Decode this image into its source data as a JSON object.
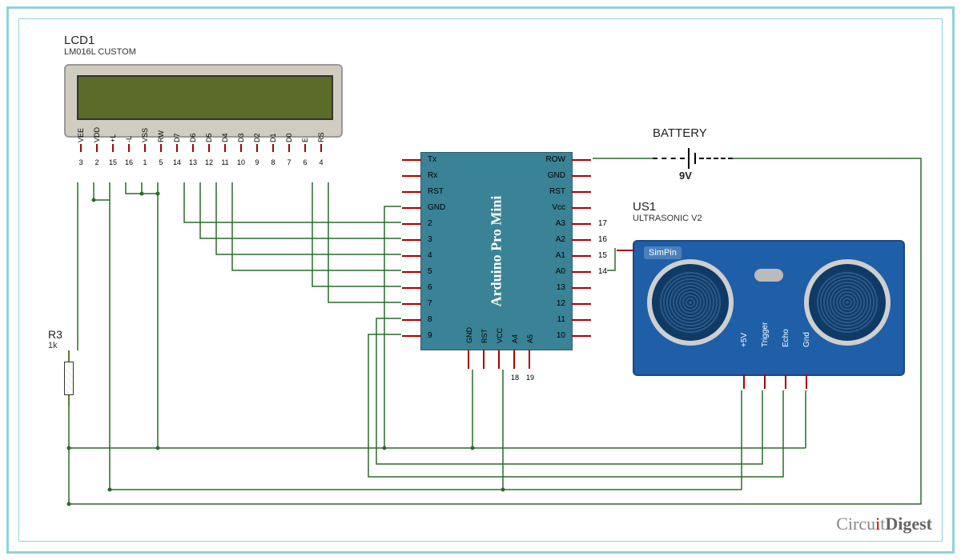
{
  "lcd": {
    "ref": "LCD1",
    "value": "LM016L CUSTOM",
    "pins": [
      {
        "label": "VEE",
        "num": "3"
      },
      {
        "label": "VDD",
        "num": "2"
      },
      {
        "label": "+L",
        "num": "15"
      },
      {
        "label": "-L",
        "num": "16"
      },
      {
        "label": "VSS",
        "num": "1"
      },
      {
        "label": "RW",
        "num": "5"
      },
      {
        "label": "D7",
        "num": "14"
      },
      {
        "label": "D6",
        "num": "13"
      },
      {
        "label": "D5",
        "num": "12"
      },
      {
        "label": "D4",
        "num": "11"
      },
      {
        "label": "D3",
        "num": "10"
      },
      {
        "label": "D2",
        "num": "9"
      },
      {
        "label": "D1",
        "num": "8"
      },
      {
        "label": "D0",
        "num": "7"
      },
      {
        "label": "E",
        "num": "6"
      },
      {
        "label": "RS",
        "num": "4"
      }
    ]
  },
  "arduino": {
    "name": "Arduino Pro Mini",
    "left_pins": [
      "Tx",
      "Rx",
      "RST",
      "GND",
      "2",
      "3",
      "4",
      "5",
      "6",
      "7",
      "8",
      "9"
    ],
    "right_pins": [
      "ROW",
      "GND",
      "RST",
      "Vcc",
      "A3",
      "A2",
      "A1",
      "A0",
      "13",
      "12",
      "11",
      "10"
    ],
    "right_nums": [
      "",
      "",
      "",
      "",
      "17",
      "16",
      "15",
      "14",
      "",
      "",
      "",
      ""
    ],
    "bottom_pins": [
      "GND",
      "RST",
      "VCC",
      "A4",
      "A5"
    ],
    "bottom_nums": [
      "",
      "",
      "",
      "18",
      "19"
    ]
  },
  "battery": {
    "ref": "BATTERY",
    "value": "9V"
  },
  "resistor": {
    "ref": "R3",
    "value": "1k"
  },
  "ultrasonic": {
    "ref": "US1",
    "value": "ULTRASONIC V2",
    "simpin": "SimPin",
    "pins": [
      "+5V",
      "Trigger",
      "Echo",
      "Gnd"
    ]
  },
  "watermark": {
    "a": "Circu",
    "b": "i",
    "c": "t",
    "d": "Digest"
  }
}
